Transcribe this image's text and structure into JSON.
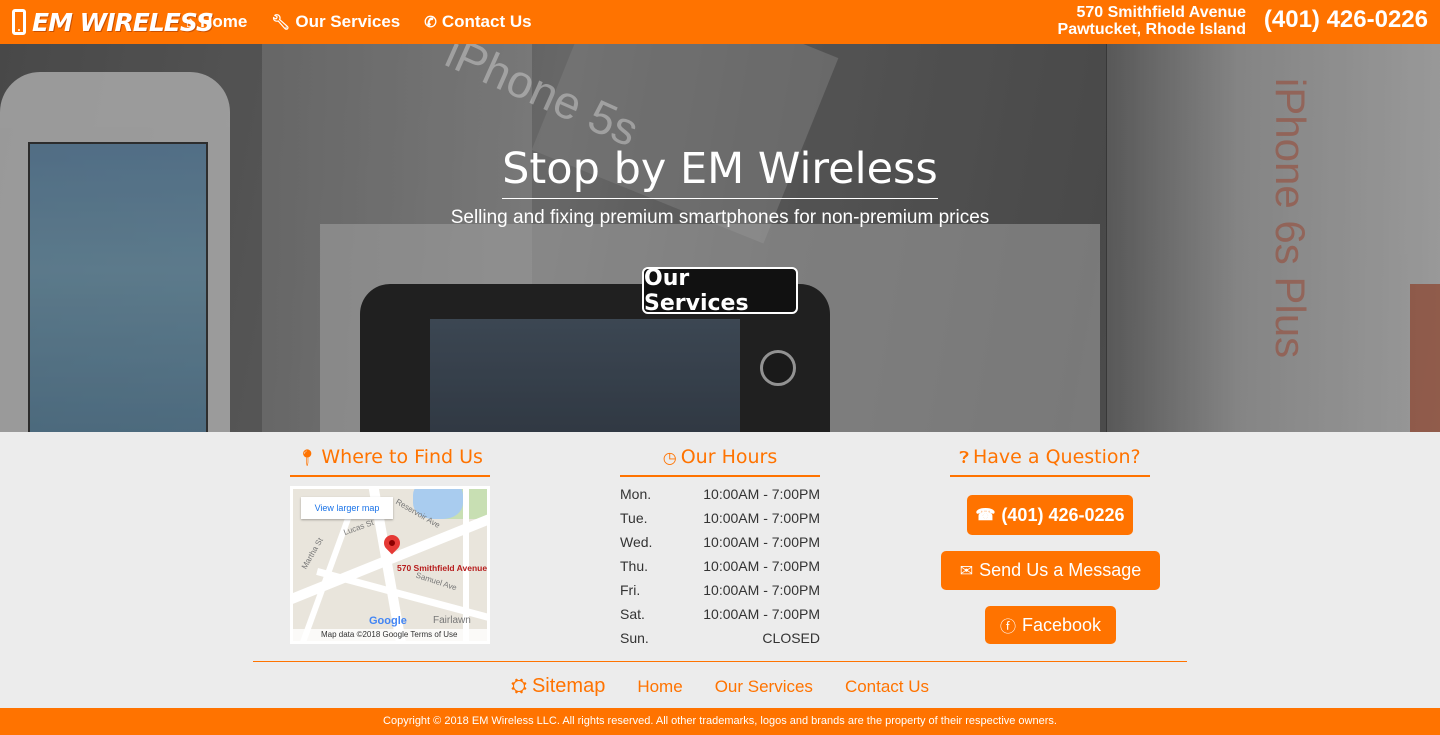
{
  "colors": {
    "brand": "#ff7300",
    "text_dark": "#333333",
    "footer_text": "#ffffff"
  },
  "navbar": {
    "logo": "EM WIRELESS",
    "links": [
      {
        "label": "Home",
        "icon": "home-icon"
      },
      {
        "label": "Our Services",
        "icon": "wrench-icon"
      },
      {
        "label": "Contact Us",
        "icon": "phone-icon"
      }
    ],
    "address_line1": "570 Smithfield Avenue",
    "address_line2": "Pawtucket, Rhode Island",
    "phone": "(401) 426-0226"
  },
  "hero": {
    "title": "Stop by EM Wireless",
    "subtitle": "Selling and fixing premium smartphones for non-premium prices",
    "cta": "Our Services",
    "background_text_1": "iPhone 5s",
    "background_text_2": "iPhone 6s Plus"
  },
  "where": {
    "heading": "Where to Find Us",
    "icon": "map-marker-icon",
    "map": {
      "larger_map": "View larger map",
      "address_label": "570 Smithfield Avenue",
      "streets": [
        "Reservoir Ave",
        "Lucas St",
        "Martha St",
        "Samuel Ave",
        "Fairlawn"
      ],
      "google": "Google",
      "attribution": "Map data ©2018 Google  Terms of Use"
    }
  },
  "hours": {
    "heading": "Our Hours",
    "icon": "clock-icon",
    "rows": [
      {
        "day": "Mon.",
        "time": "10:00AM - 7:00PM"
      },
      {
        "day": "Tue.",
        "time": "10:00AM - 7:00PM"
      },
      {
        "day": "Wed.",
        "time": "10:00AM - 7:00PM"
      },
      {
        "day": "Thu.",
        "time": "10:00AM - 7:00PM"
      },
      {
        "day": "Fri.",
        "time": "10:00AM - 7:00PM"
      },
      {
        "day": "Sat.",
        "time": "10:00AM - 7:00PM"
      },
      {
        "day": "Sun.",
        "time": "CLOSED"
      }
    ]
  },
  "question": {
    "heading": "Have a Question?",
    "icon": "question-circle-icon",
    "phone_button": "(401) 426-0226",
    "message_button": "Send Us a Message",
    "facebook_button": "Facebook"
  },
  "sitemap": {
    "title": "Sitemap",
    "links": [
      "Home",
      "Our Services",
      "Contact Us"
    ]
  },
  "footer": {
    "copyright": "Copyright © 2018 EM Wireless LLC. All rights reserved. All other trademarks, logos and brands are the property of their respective owners."
  }
}
